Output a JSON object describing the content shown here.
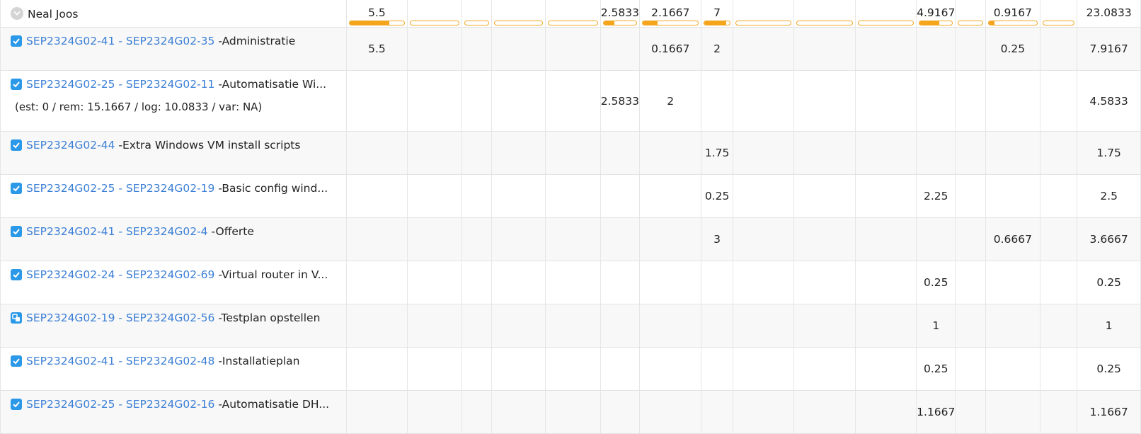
{
  "colors": {
    "accent": "#f5a51c",
    "link": "#3c7fd6",
    "checkbox": "#2b98e8"
  },
  "header": {
    "user": "Neal Joos",
    "icon": "chevron-down-circle-icon",
    "cells": [
      {
        "value": "5.5",
        "progress": 0.73
      },
      {
        "value": "",
        "progress": 0
      },
      {
        "value": "",
        "progress": 0
      },
      {
        "value": "",
        "progress": 0
      },
      {
        "value": "",
        "progress": 0
      },
      {
        "value": "2.5833",
        "progress": 0.33
      },
      {
        "value": "2.1667",
        "progress": 0.27
      },
      {
        "value": "7",
        "progress": 0.88
      },
      {
        "value": "",
        "progress": 0
      },
      {
        "value": "",
        "progress": 0
      },
      {
        "value": "",
        "progress": 0
      },
      {
        "value": "4.9167",
        "progress": 0.61
      },
      {
        "value": "",
        "progress": 0
      },
      {
        "value": "0.9167",
        "progress": 0.12
      },
      {
        "value": "",
        "progress": 0
      },
      {
        "value": "23.0833",
        "progress": null
      }
    ]
  },
  "rows": [
    {
      "icon": "checkbox-icon",
      "link": "SEP2324G02-41 - SEP2324G02-35",
      "title": " -Administratie",
      "est": "",
      "cells": [
        "5.5",
        "",
        "",
        "",
        "",
        "",
        "0.1667",
        "2",
        "",
        "",
        "",
        "",
        "",
        "0.25",
        "",
        "7.9167"
      ]
    },
    {
      "icon": "checkbox-icon",
      "link": "SEP2324G02-25 - SEP2324G02-11",
      "title": " -Automatisatie Wi...",
      "est": "(est: 0 / rem: 15.1667 / log: 10.0833 / var: NA)",
      "cells": [
        "",
        "",
        "",
        "",
        "",
        "2.5833",
        "2",
        "",
        "",
        "",
        "",
        "",
        "",
        "",
        "",
        "4.5833"
      ]
    },
    {
      "icon": "checkbox-icon",
      "link": "SEP2324G02-44",
      "title": " -Extra Windows VM install scripts",
      "est": "",
      "cells": [
        "",
        "",
        "",
        "",
        "",
        "",
        "",
        "1.75",
        "",
        "",
        "",
        "",
        "",
        "",
        "",
        "1.75"
      ]
    },
    {
      "icon": "checkbox-icon",
      "link": "SEP2324G02-25 - SEP2324G02-19",
      "title": " -Basic config wind...",
      "est": "",
      "cells": [
        "",
        "",
        "",
        "",
        "",
        "",
        "",
        "0.25",
        "",
        "",
        "",
        "2.25",
        "",
        "",
        "",
        "2.5"
      ]
    },
    {
      "icon": "checkbox-icon",
      "link": "SEP2324G02-41 - SEP2324G02-4",
      "title": " -Offerte",
      "est": "",
      "cells": [
        "",
        "",
        "",
        "",
        "",
        "",
        "",
        "3",
        "",
        "",
        "",
        "",
        "",
        "0.6667",
        "",
        "3.6667"
      ]
    },
    {
      "icon": "checkbox-icon",
      "link": "SEP2324G02-24 - SEP2324G02-69",
      "title": " -Virtual router in V...",
      "est": "",
      "cells": [
        "",
        "",
        "",
        "",
        "",
        "",
        "",
        "",
        "",
        "",
        "",
        "0.25",
        "",
        "",
        "",
        "0.25"
      ]
    },
    {
      "icon": "subtask-icon",
      "link": "SEP2324G02-19 - SEP2324G02-56",
      "title": " -Testplan opstellen",
      "est": "",
      "cells": [
        "",
        "",
        "",
        "",
        "",
        "",
        "",
        "",
        "",
        "",
        "",
        "1",
        "",
        "",
        "",
        "1"
      ]
    },
    {
      "icon": "checkbox-icon",
      "link": "SEP2324G02-41 - SEP2324G02-48",
      "title": " -Installatieplan",
      "est": "",
      "cells": [
        "",
        "",
        "",
        "",
        "",
        "",
        "",
        "",
        "",
        "",
        "",
        "0.25",
        "",
        "",
        "",
        "0.25"
      ]
    },
    {
      "icon": "checkbox-icon",
      "link": "SEP2324G02-25 - SEP2324G02-16",
      "title": " -Automatisatie DH...",
      "est": "",
      "cells": [
        "",
        "",
        "",
        "",
        "",
        "",
        "",
        "",
        "",
        "",
        "",
        "1.1667",
        "",
        "",
        "",
        "1.1667"
      ]
    }
  ]
}
